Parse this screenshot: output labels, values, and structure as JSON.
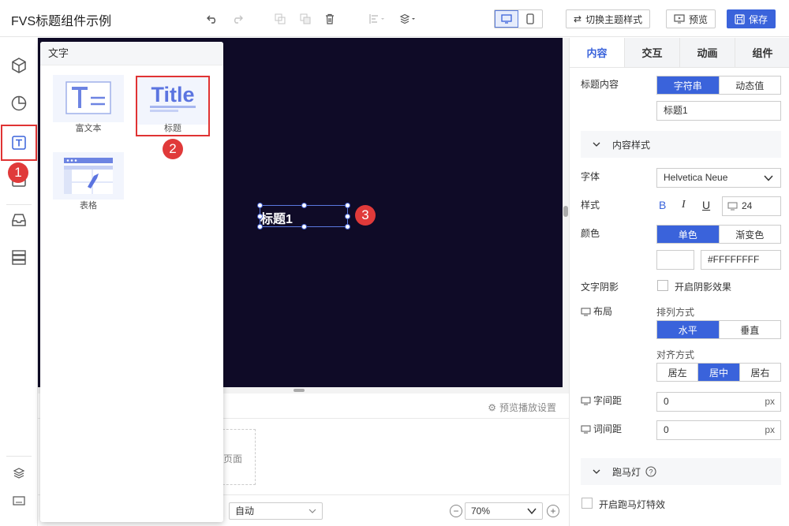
{
  "app": {
    "title": "FVS标题组件示例"
  },
  "toolbar": {
    "switch_theme": "切换主题样式",
    "preview": "预览",
    "save": "保存"
  },
  "component_panel": {
    "header": "文字",
    "items": [
      {
        "label": "富文本",
        "icon_text": "T"
      },
      {
        "label": "标题",
        "icon_text": "Title"
      },
      {
        "label": "表格"
      }
    ]
  },
  "canvas": {
    "widget_text": "标题1"
  },
  "bottom": {
    "preview_settings": "预览播放设置",
    "page_box_label": "页面",
    "auto_select": "自动",
    "zoom": "70%"
  },
  "badges": [
    "1",
    "2",
    "3"
  ],
  "right_panel": {
    "tabs": [
      "内容",
      "交互",
      "动画",
      "组件"
    ],
    "title_content_label": "标题内容",
    "title_content_options": [
      "字符串",
      "动态值"
    ],
    "title_value": "标题1",
    "content_style_section": "内容样式",
    "font_label": "字体",
    "font_value": "Helvetica Neue",
    "style_label": "样式",
    "style_bold": "B",
    "style_italic": "I",
    "style_underline": "U",
    "font_size": "24",
    "color_label": "颜色",
    "color_options": [
      "单色",
      "渐变色"
    ],
    "color_value": "#FFFFFFFF",
    "shadow_label": "文字阴影",
    "shadow_checkbox": "开启阴影效果",
    "layout_label": "布局",
    "arrange_label": "排列方式",
    "arrange_options": [
      "水平",
      "垂直"
    ],
    "align_label": "对齐方式",
    "align_options": [
      "居左",
      "居中",
      "居右"
    ],
    "letter_spacing_label": "字间距",
    "letter_spacing_value": "0",
    "word_spacing_label": "词间距",
    "word_spacing_value": "0",
    "unit": "px",
    "marquee_section": "跑马灯",
    "marquee_checkbox": "开启跑马灯特效"
  },
  "colors": {
    "accent": "#3a63db",
    "canvas_bg": "#0f0b27",
    "highlight": "#e03333"
  }
}
